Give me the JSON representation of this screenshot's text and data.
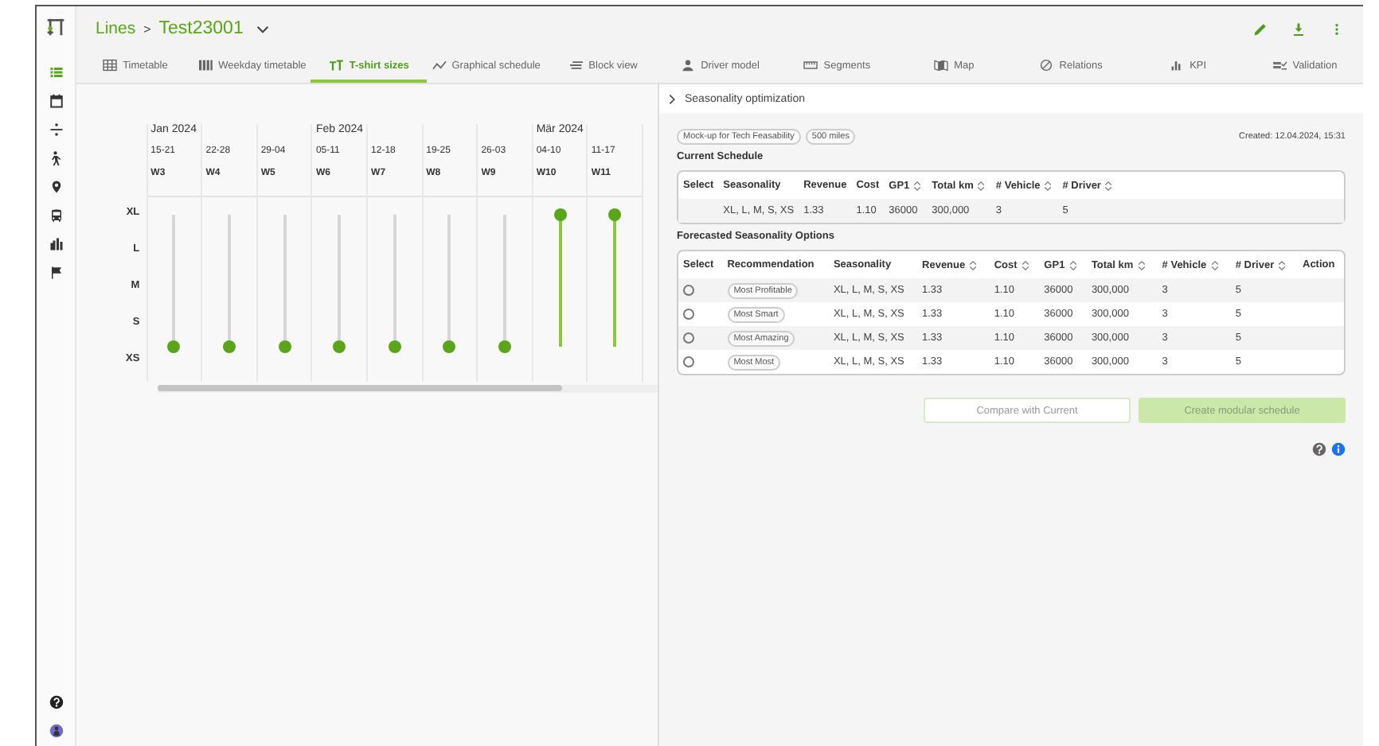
{
  "sidebar": {
    "items": [
      {
        "selected": true
      },
      {
        "selected": false
      },
      {
        "selected": false
      },
      {
        "selected": false
      },
      {
        "selected": false
      },
      {
        "selected": false
      },
      {
        "selected": false
      },
      {
        "selected": false
      }
    ]
  },
  "header": {
    "breadcrumb": "Lines",
    "separator": ">",
    "title": "Test23001"
  },
  "tabs": [
    {
      "label": "Timetable",
      "selected": false
    },
    {
      "label": "Weekday timetable",
      "selected": false
    },
    {
      "label": "T-shirt sizes",
      "selected": true
    },
    {
      "label": "Graphical schedule",
      "selected": false
    },
    {
      "label": "Block view",
      "selected": false
    },
    {
      "label": "Driver model",
      "selected": false
    },
    {
      "label": "Segments",
      "selected": false
    },
    {
      "label": "Map",
      "selected": false
    },
    {
      "label": "Relations",
      "selected": false
    },
    {
      "label": "KPI",
      "selected": false
    },
    {
      "label": "Validation",
      "selected": false
    }
  ],
  "sizes": [
    "XL",
    "L",
    "M",
    "S",
    "XS"
  ],
  "weeks": [
    {
      "month": "Jan 2024",
      "range": "15-21",
      "week": "W3",
      "level": 0
    },
    {
      "range": "22-28",
      "week": "W4",
      "level": 0
    },
    {
      "range": "29-04",
      "week": "W5",
      "level": 0
    },
    {
      "month": "Feb 2024",
      "range": "05-11",
      "week": "W6",
      "level": 0
    },
    {
      "range": "12-18",
      "week": "W7",
      "level": 0
    },
    {
      "range": "19-25",
      "week": "W8",
      "level": 0
    },
    {
      "range": "26-03",
      "week": "W9",
      "level": 0
    },
    {
      "month": "Mär 2024",
      "range": "04-10",
      "week": "W10",
      "level": 1
    },
    {
      "range": "11-17",
      "week": "W11",
      "level": 1
    }
  ],
  "panel": {
    "title": "Seasonality optimization",
    "tags": [
      "Mock-up for Tech Feasability",
      "500 miles"
    ],
    "created": "Created: 12.04.2024, 15:31",
    "current": {
      "title": "Current Schedule",
      "columns": [
        {
          "label": "Select",
          "sortable": false
        },
        {
          "label": "Seasonality",
          "sortable": false
        },
        {
          "label": "Revenue",
          "sortable": false
        },
        {
          "label": "Cost",
          "sortable": false
        },
        {
          "label": "GP1",
          "sortable": true
        },
        {
          "label": "Total km",
          "sortable": true
        },
        {
          "label": "# Vehicle",
          "sortable": true
        },
        {
          "label": "# Driver",
          "sortable": true
        }
      ],
      "rows": [
        {
          "cells": [
            "",
            "XL, L, M, S, XS",
            "1.33",
            "1.10",
            "36000",
            "300,000",
            "3",
            "5"
          ]
        }
      ]
    },
    "options": {
      "title": "Forecasted Seasonality Options",
      "columns": [
        {
          "label": "Select",
          "sortable": false
        },
        {
          "label": "Recommendation",
          "sortable": false
        },
        {
          "label": "Seasonality",
          "sortable": false
        },
        {
          "label": "Revenue",
          "sortable": true
        },
        {
          "label": "Cost",
          "sortable": true
        },
        {
          "label": "GP1",
          "sortable": true
        },
        {
          "label": "Total km",
          "sortable": true
        },
        {
          "label": "# Vehicle",
          "sortable": true
        },
        {
          "label": "# Driver",
          "sortable": true
        },
        {
          "label": "Action",
          "sortable": false
        }
      ],
      "rows": [
        {
          "selected": false,
          "cells": [
            "",
            "Most Profitable",
            "XL, L, M, S, XS",
            "1.33",
            "1.10",
            "36000",
            "300,000",
            "3",
            "5"
          ]
        },
        {
          "selected": false,
          "cells": [
            "",
            "Most Smart",
            "XL, L, M, S, XS",
            "1.33",
            "1.10",
            "36000",
            "300,000",
            "3",
            "5"
          ]
        },
        {
          "selected": false,
          "cells": [
            "",
            "Most Amazing",
            "XL, L, M, S, XS",
            "1.33",
            "1.10",
            "36000",
            "300,000",
            "3",
            "5"
          ]
        },
        {
          "selected": false,
          "cells": [
            "",
            "Most Most",
            "XL, L, M, S, XS",
            "1.33",
            "1.10",
            "36000",
            "300,000",
            "3",
            "5"
          ]
        }
      ]
    },
    "buttons": [
      {
        "label": "Compare with Current",
        "kind": "outline",
        "disabled": true
      },
      {
        "label": "Create modular schedule",
        "kind": "filled",
        "disabled": true
      }
    ]
  }
}
